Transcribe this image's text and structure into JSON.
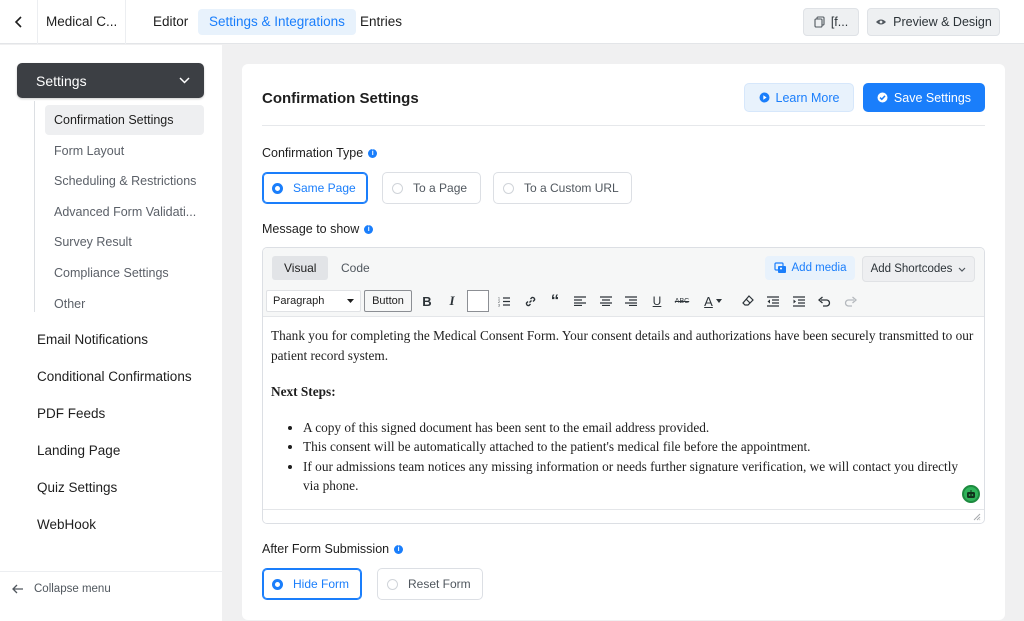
{
  "topbar": {
    "form_title": "Medical C...",
    "tabs": [
      {
        "label": "Editor"
      },
      {
        "label": "Settings & Integrations"
      },
      {
        "label": "Entries"
      }
    ],
    "shortcode_button": "[f...",
    "preview_button": "Preview & Design"
  },
  "sidebar": {
    "settings_label": "Settings",
    "sub_items": [
      {
        "label": "Confirmation Settings"
      },
      {
        "label": "Form Layout"
      },
      {
        "label": "Scheduling & Restrictions"
      },
      {
        "label": "Advanced Form Validati..."
      },
      {
        "label": "Survey Result"
      },
      {
        "label": "Compliance Settings"
      },
      {
        "label": "Other"
      }
    ],
    "main_items": [
      {
        "label": "Email Notifications"
      },
      {
        "label": "Conditional Confirmations"
      },
      {
        "label": "PDF Feeds"
      },
      {
        "label": "Landing Page"
      },
      {
        "label": "Quiz Settings"
      },
      {
        "label": "WebHook"
      }
    ],
    "collapse_label": "Collapse menu"
  },
  "main": {
    "title": "Confirmation Settings",
    "learn_more": "Learn More",
    "save": "Save Settings",
    "confirmation_type_label": "Confirmation Type",
    "confirmation_options": [
      {
        "label": "Same Page",
        "selected": true
      },
      {
        "label": "To a Page",
        "selected": false
      },
      {
        "label": "To a Custom URL",
        "selected": false
      }
    ],
    "message_label": "Message to show",
    "editor": {
      "tab_visual": "Visual",
      "tab_code": "Code",
      "add_media": "Add media",
      "add_shortcodes": "Add Shortcodes",
      "format_select": "Paragraph",
      "button_label": "Button",
      "content": {
        "intro": "Thank you for completing the Medical Consent Form. Your consent details and authorizations have been securely transmitted to our patient record system.",
        "heading": "Next Steps:",
        "bullets": [
          "A copy of this signed document has been sent to the email address provided.",
          "This consent will be automatically attached to the patient's medical file before the appointment.",
          "If our admissions team notices any missing information or needs further signature verification, we will contact you directly via phone."
        ]
      }
    },
    "after_submission_label": "After Form Submission",
    "after_options": [
      {
        "label": "Hide Form",
        "selected": true
      },
      {
        "label": "Reset Form",
        "selected": false
      }
    ]
  },
  "colors": {
    "accent": "#1a7efb",
    "sidebar_active": "#3c3f44",
    "badge_green": "#2fb35a"
  }
}
